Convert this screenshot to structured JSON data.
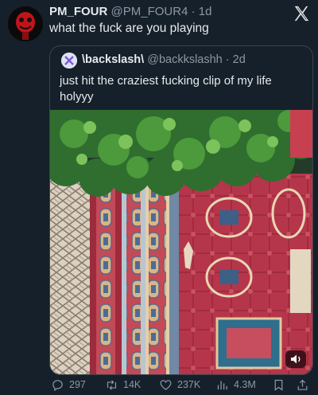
{
  "tweet": {
    "display_name": "PM_FOUR",
    "handle": "@PM_FOUR4",
    "time": "1d",
    "text": "what the fuck are you playing"
  },
  "quoted": {
    "display_name": "\\backslash\\",
    "handle": "@backkslashh",
    "time": "2d",
    "text": "just hit the craziest fucking clip of my life holyyy"
  },
  "actions": {
    "replies": "297",
    "retweets": "14K",
    "likes": "237K",
    "views": "4.3M"
  },
  "icons": {
    "logo": "x-logo-icon",
    "reply": "reply-icon",
    "retweet": "retweet-icon",
    "like": "heart-icon",
    "views": "views-icon",
    "bookmark": "bookmark-icon",
    "share": "share-icon",
    "sound": "speaker-icon"
  },
  "colors": {
    "background": "#15202b",
    "text": "#e7e9ea",
    "muted": "#8b98a5",
    "border": "#38444d"
  }
}
